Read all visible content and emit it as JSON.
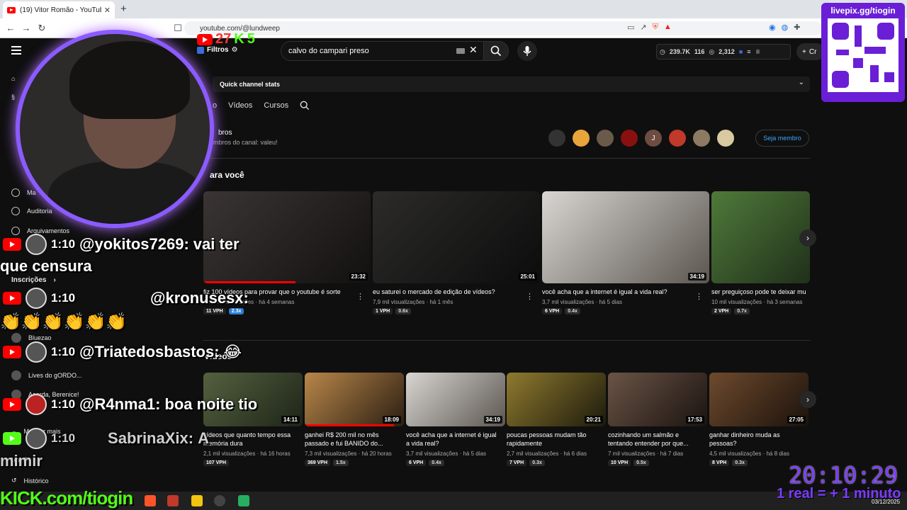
{
  "browser": {
    "tab_title": "(19) Vitor Romão - YouTube",
    "url": "youtube.com/@lundweep"
  },
  "youtube": {
    "filters_label": "Filtros",
    "search_value": "calvo do campari preso",
    "stats": {
      "views": "239.7K",
      "count1": "116",
      "count2": "2,312"
    },
    "create_label": "Cr"
  },
  "sidebar": {
    "items": [
      {
        "label": "Ma",
        "icon": "circle"
      },
      {
        "label": "Auditoria",
        "icon": "circle"
      },
      {
        "label": "Arquivamentos",
        "icon": "circle"
      }
    ],
    "subscriptions_label": "Inscrições",
    "subs": [
      {
        "label": "Bluezao"
      },
      {
        "label": "Lives do gORDO..."
      },
      {
        "label": "Acorda, Berenice!"
      }
    ],
    "show_more": "Mostrar mais",
    "you_label": "Você",
    "history_label": "Histórico"
  },
  "channel": {
    "quick_stats": "Quick channel stats",
    "tabs": [
      "Vídeos",
      "Cursos"
    ],
    "members_title": "bros",
    "members_sub": "embros do canal: valeu!",
    "join_label": "Seja membro",
    "for_you_title": "ara você",
    "videos_title": "Vídeos",
    "for_you": [
      {
        "title": "fiz 100 vídeos para provar que o youtube é sorte",
        "meta": "32 mil visualizações · há 4 semanas",
        "vph": "11 VPH",
        "mult": "2.3x",
        "mult_hl": true,
        "duration": "23:32",
        "progress": 0.55
      },
      {
        "title": "eu saturei o mercado de edição de vídeos?",
        "meta": "7,9 mil visualizações · há 1 mês",
        "vph": "1 VPH",
        "mult": "0.6x",
        "mult_hl": false,
        "duration": "25:01",
        "progress": 0
      },
      {
        "title": "você acha que a internet é igual a vida real?",
        "meta": "3,7 mil visualizações · há 5 dias",
        "vph": "6 VPH",
        "mult": "0.4x",
        "mult_hl": false,
        "duration": "34:19",
        "progress": 0
      },
      {
        "title": "ser preguiçoso pode te deixar mu",
        "meta": "10 mil visualizações · há 3 semanas",
        "vph": "2 VPH",
        "mult": "0.7x",
        "mult_hl": false,
        "duration": "",
        "progress": 0
      }
    ],
    "videos": [
      {
        "title": "vídeos que quanto tempo essa memória dura",
        "meta": "2,1 mil visualizações · há 16 horas",
        "vph": "107 VPH",
        "mult": "",
        "duration": "14:11",
        "progress": 0
      },
      {
        "title": "ganhei R$ 200 mil no mês passado e fui BANIDO do...",
        "meta": "7,3 mil visualizações · há 20 horas",
        "vph": "369 VPH",
        "mult": "1.5x",
        "duration": "18:09",
        "progress": 0.9
      },
      {
        "title": "você acha que a internet é igual a vida real?",
        "meta": "3,7 mil visualizações · há 5 dias",
        "vph": "6 VPH",
        "mult": "0.4x",
        "duration": "34:19",
        "progress": 0
      },
      {
        "title": "poucas pessoas mudam tão rapidamente",
        "meta": "2,7 mil visualizações · há 6 dias",
        "vph": "7 VPH",
        "mult": "0.3x",
        "duration": "20:21",
        "progress": 0
      },
      {
        "title": "cozinhando um salmão e tentando entender por que...",
        "meta": "7 mil visualizações · há 7 dias",
        "vph": "10 VPH",
        "mult": "0.5x",
        "duration": "17:53",
        "progress": 0
      },
      {
        "title": "ganhar dinheiro muda as pessoas?",
        "meta": "4,5 mil visualizações · há 8 dias",
        "vph": "8 VPH",
        "mult": "0.3x",
        "duration": "27:05",
        "progress": 0
      }
    ]
  },
  "overlay": {
    "yt_count": "27",
    "kick_count": "5",
    "qr_label": "livepix.gg/tiogin",
    "clock": "20:10:29",
    "promo": "1 real = + 1 minuto",
    "kick_url": "KICK.com/tiogin",
    "date": "03/12/2025",
    "chat": [
      {
        "time": "1:10",
        "user": "@yokitos7269:",
        "msg": "vai ter"
      },
      {
        "time": "",
        "user": "",
        "msg": "que censura"
      },
      {
        "time": "1:10",
        "user": "@kronusesx:",
        "msg": ""
      },
      {
        "time": "1:10",
        "user": "@Triatedosbastos:",
        "msg": ""
      },
      {
        "time": "1:10",
        "user": "@R4nma1:",
        "msg": "boa noite tio"
      },
      {
        "time": "1:10",
        "user": "SabrinaXix:",
        "msg": "A"
      },
      {
        "time": "",
        "user": "",
        "msg": "mimir"
      }
    ]
  }
}
